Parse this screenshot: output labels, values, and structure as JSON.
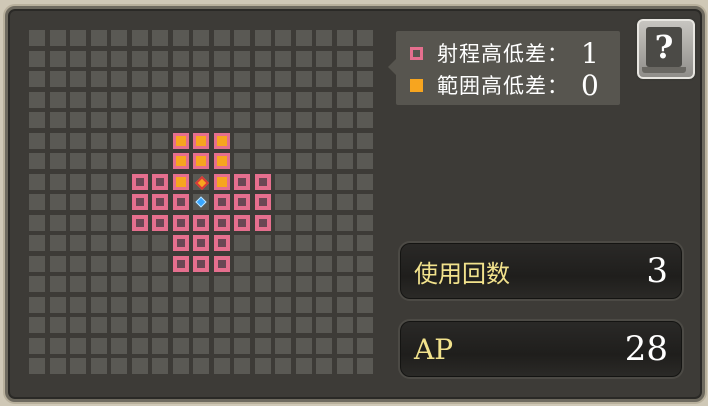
{
  "legend": {
    "range_height_label": "射程高低差：",
    "range_height_value": "1",
    "area_height_label": "範囲高低差：",
    "area_height_value": "0"
  },
  "help_button": {
    "label": "?"
  },
  "uses": {
    "label": "使用回数",
    "value": "3"
  },
  "ap": {
    "label": "AP",
    "value": "28"
  },
  "colors": {
    "range": "#e56f8e",
    "area": "#f7a51f",
    "caster": "#38a6ff",
    "target": "#d83a3a",
    "label_gold": "#f2e28c"
  },
  "grid": {
    "cols": 17,
    "rows": 17,
    "area_cells": [
      [
        7,
        5
      ],
      [
        8,
        5
      ],
      [
        9,
        5
      ],
      [
        7,
        6
      ],
      [
        8,
        6
      ],
      [
        9,
        6
      ],
      [
        7,
        7
      ],
      [
        9,
        7
      ]
    ],
    "range_cells": [
      [
        5,
        7
      ],
      [
        6,
        7
      ],
      [
        10,
        7
      ],
      [
        11,
        7
      ],
      [
        5,
        8
      ],
      [
        6,
        8
      ],
      [
        7,
        8
      ],
      [
        9,
        8
      ],
      [
        10,
        8
      ],
      [
        11,
        8
      ],
      [
        5,
        9
      ],
      [
        6,
        9
      ],
      [
        7,
        9
      ],
      [
        8,
        9
      ],
      [
        9,
        9
      ],
      [
        10,
        9
      ],
      [
        11,
        9
      ],
      [
        7,
        10
      ],
      [
        8,
        10
      ],
      [
        9,
        10
      ],
      [
        7,
        11
      ],
      [
        8,
        11
      ],
      [
        9,
        11
      ]
    ],
    "target_cell": [
      8,
      7
    ],
    "caster_cell": [
      8,
      8
    ]
  }
}
